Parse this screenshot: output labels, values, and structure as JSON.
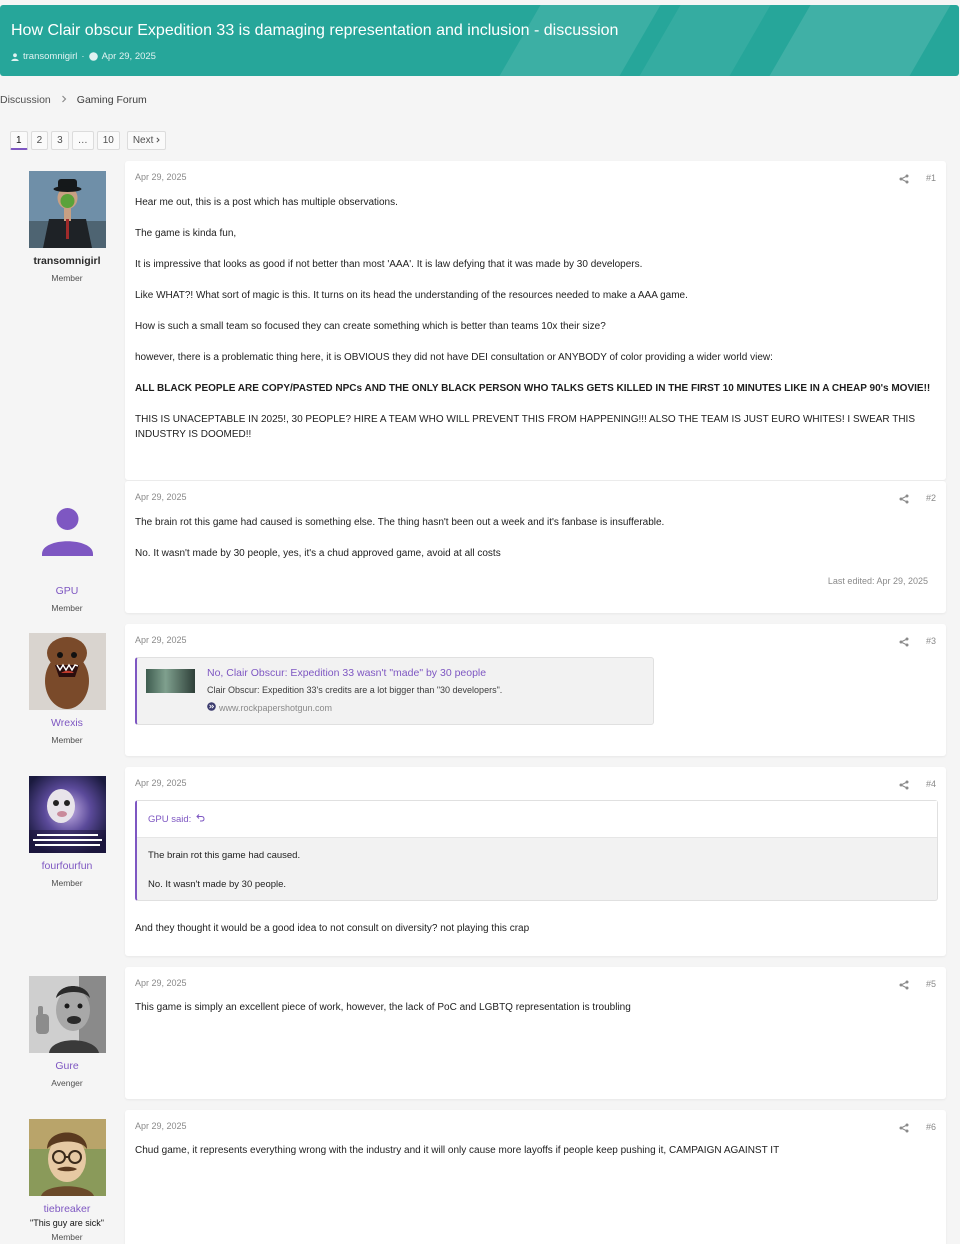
{
  "thread": {
    "title": "How Clair obscur Expedition 33 is damaging representation and inclusion - discussion",
    "author": "transomnigirl",
    "date": "Apr 29, 2025"
  },
  "breadcrumb": [
    "Discussion",
    "Gaming Forum"
  ],
  "pagination": {
    "pages": [
      "1",
      "2",
      "3",
      "…",
      "10"
    ],
    "current": "1",
    "next_label": "Next"
  },
  "colors": {
    "banner": "#26a69a",
    "accent": "#7e57c2"
  },
  "posts": [
    {
      "number": "#1",
      "date": "Apr 29, 2025",
      "user": {
        "name": "transomnigirl",
        "title": "Member"
      },
      "paragraphs": [
        "Hear me out, this is a post which has multiple observations.",
        "The game is kinda fun,",
        "It is impressive that looks as good if not better than most 'AAA'. It is law defying that it was made by 30 developers.",
        "Like WHAT?! What sort of magic is this. It turns on its head the understanding of the resources needed to make a AAA game.",
        "How is such a small team so focused they can create something which is better than teams 10x their size?",
        "however, there is a problematic thing here, it is OBVIOUS they did not have DEI consultation or ANYBODY of color providing a wider world view:",
        "ALL BLACK PEOPLE ARE COPY/PASTED NPCs AND THE ONLY BLACK PERSON WHO TALKS GETS KILLED IN THE FIRST 10 MINUTES LIKE IN A CHEAP 90's MOVIE!!",
        "THIS IS UNACEPTABLE IN 2025!, 30 PEOPLE? HIRE A TEAM WHO WILL PREVENT THIS FROM HAPPENING!!! ALSO THE TEAM IS JUST EURO WHITES! I SWEAR THIS INDUSTRY IS DOOMED!!"
      ]
    },
    {
      "number": "#2",
      "date": "Apr 29, 2025",
      "user": {
        "name": "GPU",
        "title": "Member"
      },
      "paragraphs": [
        "The brain rot this game had caused is something else. The thing hasn't been out a week and it's fanbase is insufferable.",
        "No. It wasn't made by 30 people, yes, it's a chud approved game, avoid at all costs"
      ],
      "edited": "Last edited: Apr 29, 2025"
    },
    {
      "number": "#3",
      "date": "Apr 29, 2025",
      "user": {
        "name": "Wrexis",
        "title": "Member"
      },
      "embed": {
        "title": "No, Clair Obscur: Expedition 33 wasn't \"made\" by 30 people",
        "description": "Clair Obscur: Expedition 33's credits are a lot bigger than \"30 developers\".",
        "source": "www.rockpapershotgun.com"
      }
    },
    {
      "number": "#4",
      "date": "Apr 29, 2025",
      "user": {
        "name": "fourfourfun",
        "title": "Member"
      },
      "quote": {
        "header": "GPU said:",
        "lines": [
          "The brain rot this game had caused.",
          "No. It wasn't made by 30 people."
        ]
      },
      "paragraphs": [
        "And they thought it would be a good idea to not consult on diversity? not playing this crap"
      ]
    },
    {
      "number": "#5",
      "date": "Apr 29, 2025",
      "user": {
        "name": "Gure",
        "title": "Avenger"
      },
      "paragraphs": [
        "This game is simply an excellent piece of work, however, the lack of PoC and LGBTQ representation is troubling"
      ]
    },
    {
      "number": "#6",
      "date": "Apr 29, 2025",
      "user": {
        "name": "tiebreaker",
        "tagline": "\"This guy are sick\"",
        "title": "Member"
      },
      "paragraphs": [
        "Chud game, it represents everything wrong with the industry and it will only cause more layoffs if people keep pushing it, CAMPAIGN AGAINST IT"
      ]
    }
  ]
}
